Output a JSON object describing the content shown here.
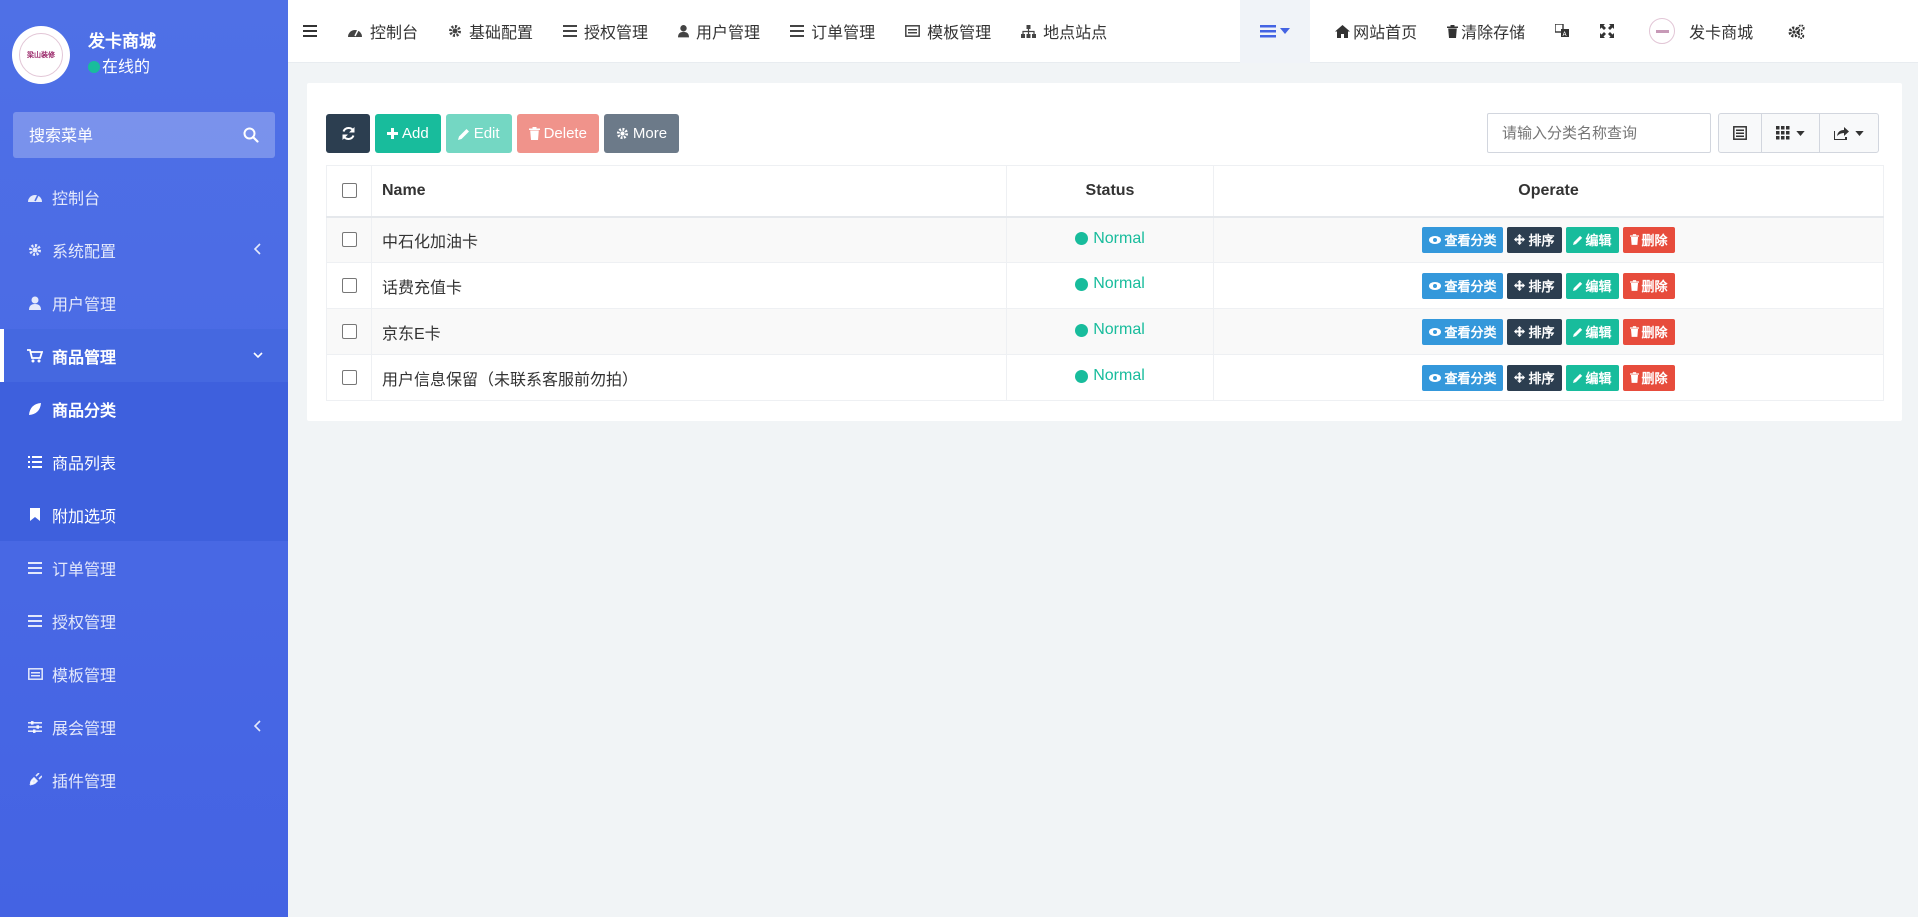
{
  "sidebar": {
    "logo_text": "梁山装修",
    "user_name": "发卡商城",
    "user_status": "在线的",
    "search_placeholder": "搜索菜单",
    "items": [
      {
        "label": "控制台",
        "icon": "dashboard-icon"
      },
      {
        "label": "系统配置",
        "icon": "gear-icon",
        "has_children": true
      },
      {
        "label": "用户管理",
        "icon": "user-icon"
      },
      {
        "label": "商品管理",
        "icon": "cart-icon",
        "active": true,
        "expanded": true
      },
      {
        "label": "订单管理",
        "icon": "list-icon"
      },
      {
        "label": "授权管理",
        "icon": "list-icon"
      },
      {
        "label": "模板管理",
        "icon": "template-icon"
      },
      {
        "label": "展会管理",
        "icon": "sliders-icon",
        "has_children": true
      },
      {
        "label": "插件管理",
        "icon": "plug-icon"
      }
    ],
    "submenu": [
      {
        "label": "商品分类",
        "icon": "leaf-icon",
        "current": true
      },
      {
        "label": "商品列表",
        "icon": "list-icon"
      },
      {
        "label": "附加选项",
        "icon": "bookmark-icon"
      }
    ]
  },
  "topnav": {
    "items": [
      {
        "label": "控制台"
      },
      {
        "label": "基础配置"
      },
      {
        "label": "授权管理"
      },
      {
        "label": "用户管理"
      },
      {
        "label": "订单管理"
      },
      {
        "label": "模板管理"
      },
      {
        "label": "地点站点"
      }
    ],
    "site_home": "网站首页",
    "clear_cache": "清除存储",
    "user_name": "发卡商城"
  },
  "toolbar": {
    "add": "Add",
    "edit": "Edit",
    "delete": "Delete",
    "more": "More",
    "search_placeholder": "请输入分类名称查询"
  },
  "table": {
    "headers": {
      "name": "Name",
      "status": "Status",
      "operate": "Operate"
    },
    "rows": [
      {
        "name": "中石化加油卡",
        "status": "Normal"
      },
      {
        "name": "话费充值卡",
        "status": "Normal"
      },
      {
        "name": "京东E卡",
        "status": "Normal"
      },
      {
        "name": "用户信息保留（未联系客服前勿拍）",
        "status": "Normal"
      }
    ],
    "actions": {
      "view": "查看分类",
      "sort": "排序",
      "edit": "编辑",
      "delete": "删除"
    }
  },
  "colors": {
    "sidebar": "#4f70e6",
    "primary": "#18bc9c",
    "dark": "#2c3e50",
    "info": "#3498db",
    "danger": "#e74c3c"
  }
}
